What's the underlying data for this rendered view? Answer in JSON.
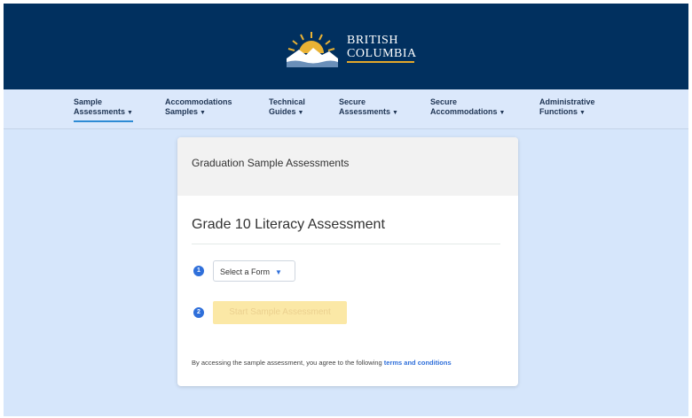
{
  "header": {
    "logo_line1": "BRITISH",
    "logo_line2": "COLUMBIA"
  },
  "nav": {
    "items": [
      {
        "line1": "Sample",
        "line2": "Assessments"
      },
      {
        "line1": "Accommodations",
        "line2": "Samples"
      },
      {
        "line1": "Technical",
        "line2": "Guides"
      },
      {
        "line1": "Secure",
        "line2": "Assessments"
      },
      {
        "line1": "Secure",
        "line2": "Accommodations"
      },
      {
        "line1": "Administrative",
        "line2": "Functions"
      }
    ],
    "active_index": 0
  },
  "card": {
    "header_title": "Graduation Sample Assessments",
    "assessment_title": "Grade 10 Literacy Assessment",
    "step1_number": "1",
    "select_label": "Select a Form",
    "step2_number": "2",
    "start_button": "Start Sample Assessment",
    "terms_text": "By accessing the sample assessment, you agree to the following",
    "terms_link": "terms and conditions"
  },
  "colors": {
    "header_bg": "#01305f",
    "page_bg": "#d6e6fb",
    "accent_blue": "#2f6fda",
    "disabled_button": "#fbe8a6",
    "logo_gold": "#e3a82b"
  },
  "icons": {
    "logo": "bc-sun-mountain-logo",
    "dropdown": "chevron-down-icon"
  }
}
